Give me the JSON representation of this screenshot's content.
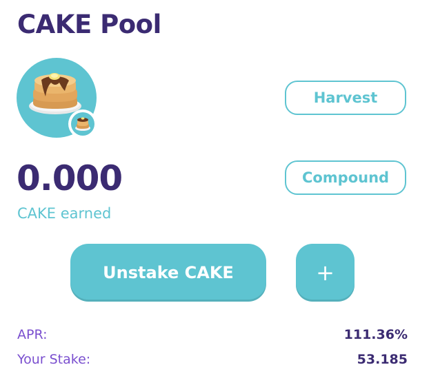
{
  "pool": {
    "title": "CAKE Pool",
    "token_icon": "pancake-stack-icon",
    "badge_icon": "pancake-stack-icon"
  },
  "actions": {
    "harvest_label": "Harvest",
    "compound_label": "Compound",
    "unstake_label": "Unstake CAKE",
    "add_label": "+"
  },
  "earned": {
    "value": "0.000",
    "label": "CAKE earned"
  },
  "stats": {
    "apr_label": "APR:",
    "apr_value": "111.36%",
    "stake_label": "Your Stake:",
    "stake_value": "53.185"
  },
  "colors": {
    "accent": "#5ec4d1",
    "heading": "#3b2b72",
    "label_purple": "#7a4fcf"
  }
}
